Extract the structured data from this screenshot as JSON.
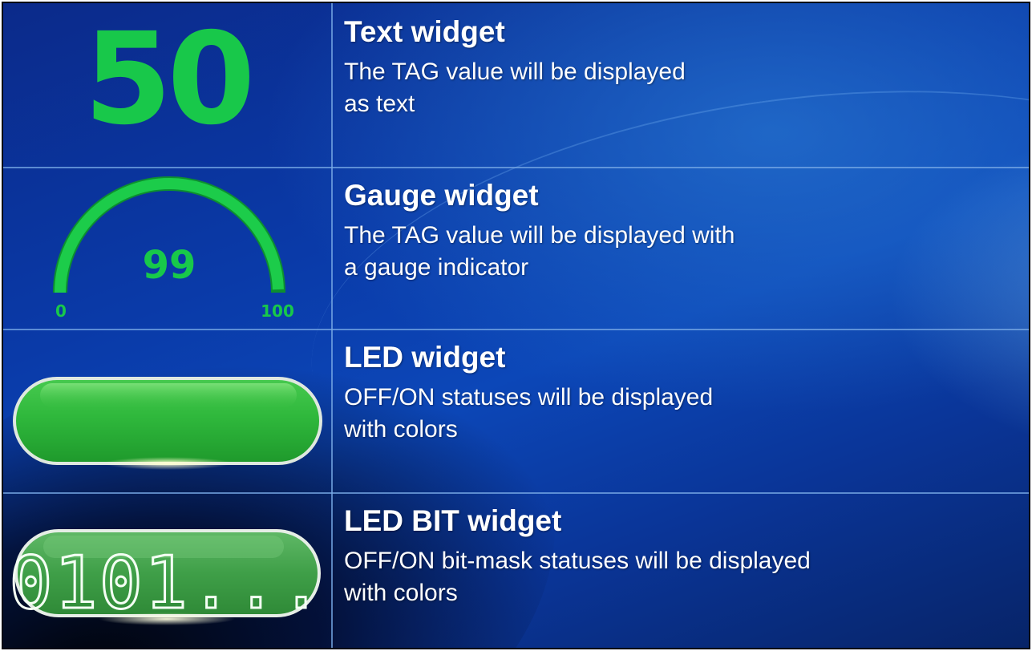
{
  "rows": [
    {
      "title": "Text widget",
      "desc_line1": "The TAG value will be displayed",
      "desc_line2": "as text"
    },
    {
      "title": "Gauge widget",
      "desc_line1": "The TAG value will be displayed with",
      "desc_line2": "a gauge indicator"
    },
    {
      "title": "LED widget",
      "desc_line1": "OFF/ON statuses will be displayed",
      "desc_line2": "with colors"
    },
    {
      "title": "LED BIT widget",
      "desc_line1": "OFF/ON bit-mask statuses will be displayed",
      "desc_line2": "with colors"
    }
  ],
  "text_widget": {
    "value": "50"
  },
  "gauge_widget": {
    "value": "99",
    "min": "0",
    "max": "100",
    "level": 0.99
  },
  "led_widget": {
    "state": "ON"
  },
  "led_bit_widget": {
    "text": "0101..."
  },
  "colors": {
    "widget_green": "#18c84a",
    "led_green": "#2fb83c",
    "background_blue": "#0a3aa8"
  }
}
